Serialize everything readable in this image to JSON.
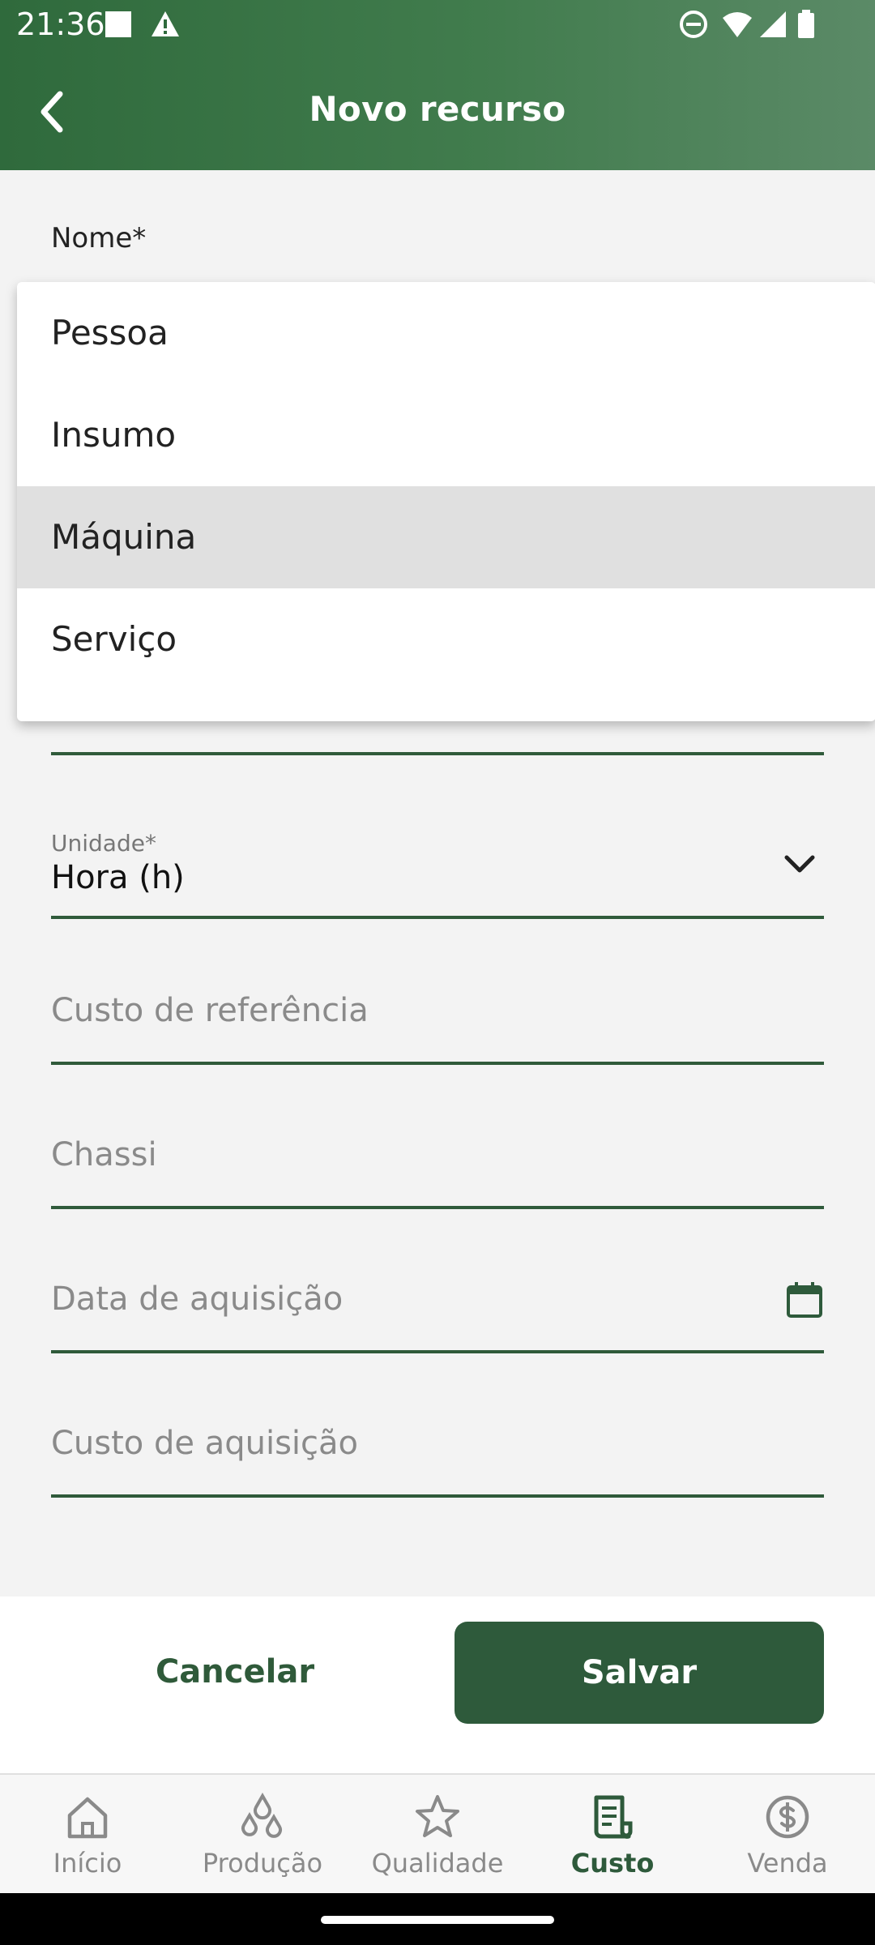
{
  "status_bar": {
    "time": "21:36"
  },
  "header": {
    "title": "Novo recurso"
  },
  "form": {
    "nome_label": "Nome*",
    "unidade": {
      "label": "Unidade*",
      "value": "Hora (h)"
    },
    "custo_referencia": {
      "placeholder": "Custo de referência"
    },
    "chassi": {
      "placeholder": "Chassi"
    },
    "data_aquisicao": {
      "placeholder": "Data de aquisição"
    },
    "custo_aquisicao": {
      "placeholder": "Custo de aquisição"
    }
  },
  "dropdown": {
    "items": [
      "Pessoa",
      "Insumo",
      "Máquina",
      "Serviço"
    ],
    "selected": "Máquina"
  },
  "actions": {
    "cancel_label": "Cancelar",
    "save_label": "Salvar"
  },
  "bottom_nav": {
    "items": [
      {
        "label": "Início",
        "icon": "home-icon"
      },
      {
        "label": "Produção",
        "icon": "drops-icon"
      },
      {
        "label": "Qualidade",
        "icon": "star-icon"
      },
      {
        "label": "Custo",
        "icon": "receipt-icon"
      },
      {
        "label": "Venda",
        "icon": "dollar-circle-icon"
      }
    ],
    "active": "Custo"
  },
  "colors": {
    "primary": "#2e5a3b",
    "appbar": "#417c4d",
    "background": "#f3f3f3"
  }
}
